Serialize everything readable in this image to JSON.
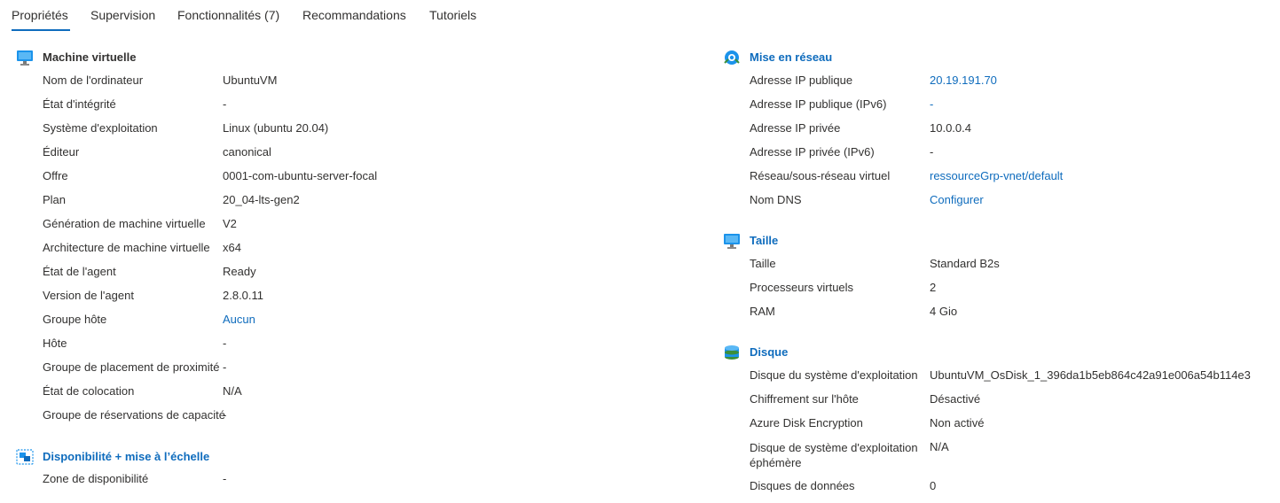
{
  "tabs": [
    {
      "label": "Propriétés"
    },
    {
      "label": "Supervision"
    },
    {
      "label": "Fonctionnalités (7)"
    },
    {
      "label": "Recommandations"
    },
    {
      "label": "Tutoriels"
    }
  ],
  "vm": {
    "title": "Machine virtuelle",
    "rows": [
      {
        "label": "Nom de l'ordinateur",
        "value": "UbuntuVM"
      },
      {
        "label": "État d'intégrité",
        "value": "-"
      },
      {
        "label": "Système d'exploitation",
        "value": "Linux (ubuntu 20.04)"
      },
      {
        "label": "Éditeur",
        "value": "canonical"
      },
      {
        "label": "Offre",
        "value": "0001-com-ubuntu-server-focal"
      },
      {
        "label": "Plan",
        "value": "20_04-lts-gen2"
      },
      {
        "label": "Génération de machine virtuelle",
        "value": "V2"
      },
      {
        "label": "Architecture de machine virtuelle",
        "value": "x64"
      },
      {
        "label": "État de l'agent",
        "value": "Ready"
      },
      {
        "label": "Version de l'agent",
        "value": "2.8.0.11"
      },
      {
        "label": "Groupe hôte",
        "value": "Aucun"
      },
      {
        "label": "Hôte",
        "value": "-"
      },
      {
        "label": "Groupe de placement de proximité",
        "value": "-"
      },
      {
        "label": "État de colocation",
        "value": "N/A"
      },
      {
        "label": "Groupe de réservations de capacité",
        "value": "-"
      }
    ]
  },
  "availability": {
    "title": "Disponibilité + mise à l’échelle",
    "rows": [
      {
        "label": "Zone de disponibilité",
        "value": "-"
      }
    ]
  },
  "network": {
    "title": "Mise en réseau",
    "rows": [
      {
        "label": "Adresse IP publique",
        "value": "20.19.191.70"
      },
      {
        "label": "Adresse IP publique (IPv6)",
        "value": "-"
      },
      {
        "label": "Adresse IP privée",
        "value": "10.0.0.4"
      },
      {
        "label": "Adresse IP privée (IPv6)",
        "value": "-"
      },
      {
        "label": "Réseau/sous-réseau virtuel",
        "value": "ressourceGrp-vnet/default"
      },
      {
        "label": "Nom DNS",
        "value": "Configurer"
      }
    ]
  },
  "size": {
    "title": "Taille",
    "rows": [
      {
        "label": "Taille",
        "value": "Standard B2s"
      },
      {
        "label": "Processeurs virtuels",
        "value": "2"
      },
      {
        "label": "RAM",
        "value": "4 Gio"
      }
    ]
  },
  "disk": {
    "title": "Disque",
    "rows": [
      {
        "label": "Disque du système d'exploitation",
        "value": "UbuntuVM_OsDisk_1_396da1b5eb864c42a91e006a54b114e3"
      },
      {
        "label": "Chiffrement sur l'hôte",
        "value": "Désactivé"
      },
      {
        "label": "Azure Disk Encryption",
        "value": "Non activé"
      },
      {
        "label": "Disque de système d'exploitation éphémère",
        "value": "N/A"
      },
      {
        "label": "Disques de données",
        "value": "0"
      }
    ]
  },
  "colors": {
    "link": "#0f6cbd",
    "text": "#323130",
    "tab_underline": "#0f6cbd"
  }
}
